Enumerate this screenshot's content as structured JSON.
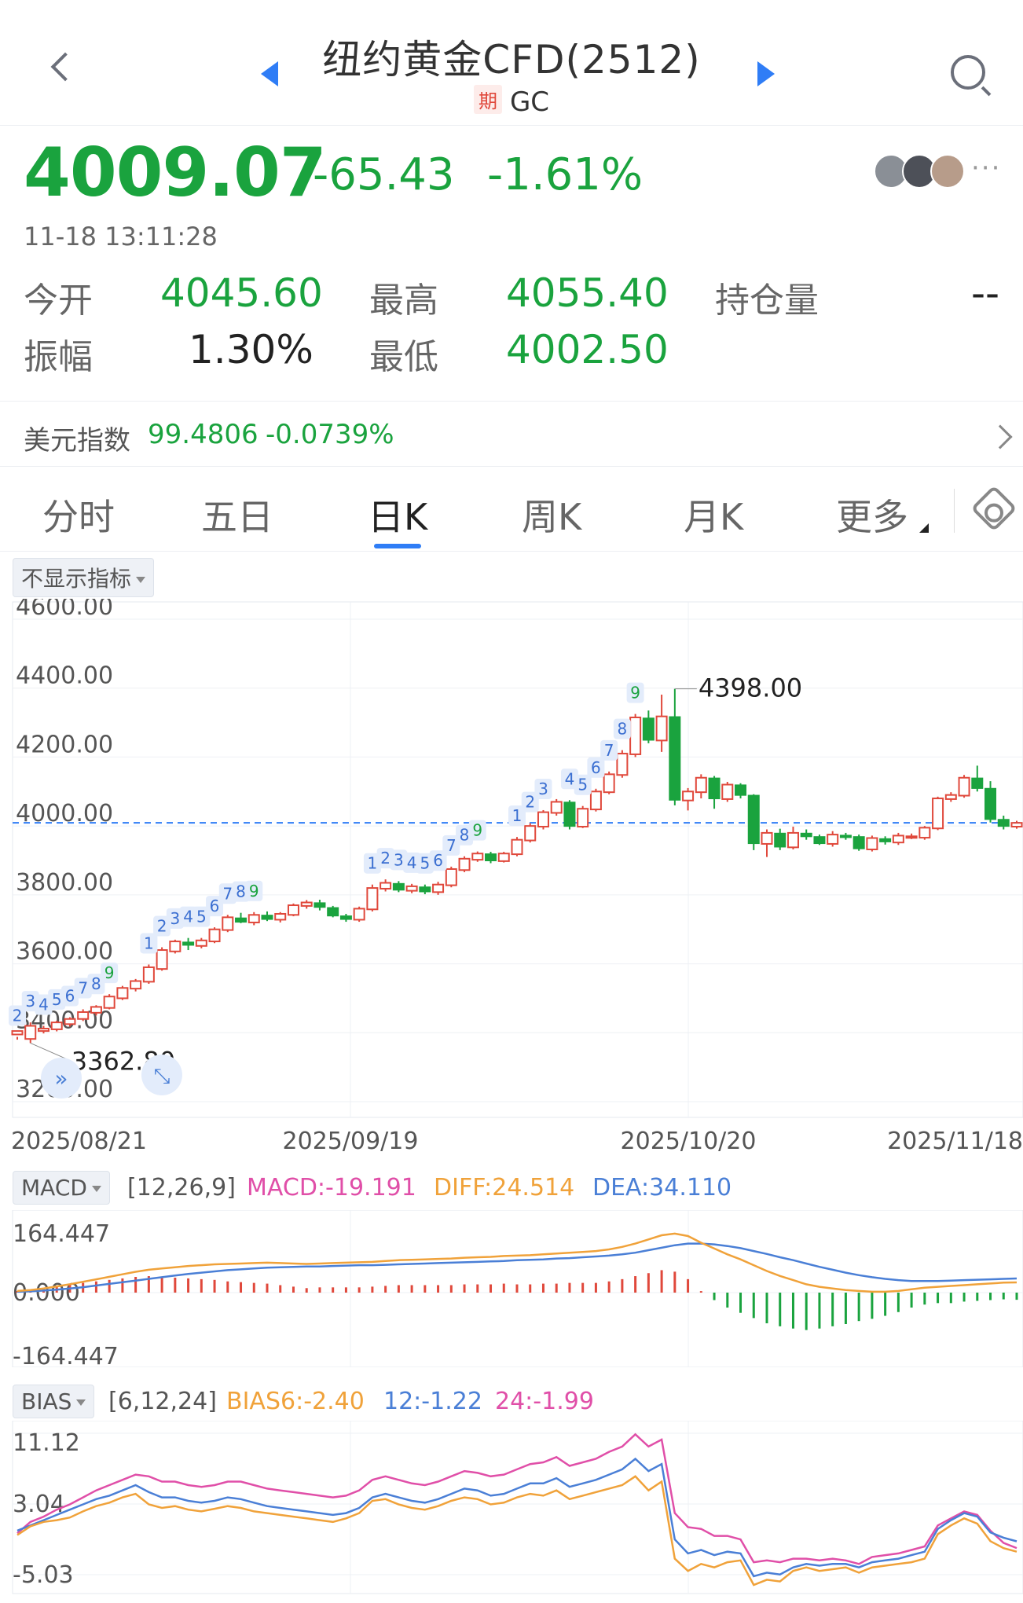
{
  "header": {
    "title": "纽约黄金CFD(2512)",
    "badge": "期",
    "code": "GC"
  },
  "quote": {
    "price": "4009.07",
    "change": "-65.43",
    "change_pct": "-1.61%",
    "timestamp": "11-18 13:11:28",
    "more": "···"
  },
  "stats": {
    "open_label": "今开",
    "open": "4045.60",
    "high_label": "最高",
    "high": "4055.40",
    "oi_label": "持仓量",
    "oi": "--",
    "amp_label": "振幅",
    "amp": "1.30%",
    "low_label": "最低",
    "low": "4002.50"
  },
  "dxy": {
    "label": "美元指数",
    "value": "99.4806",
    "change": "-0.0739%"
  },
  "tabs": [
    "分时",
    "五日",
    "日K",
    "周K",
    "月K",
    "更多"
  ],
  "active_tab": "日K",
  "indicator_toggle": "不显示指标",
  "colors": {
    "up": "#e0483b",
    "down": "#1aa33e",
    "blue": "#2f7df6",
    "orange": "#f0a23a",
    "pink": "#e04fa8",
    "dea_blue": "#4a7fd6"
  },
  "chart_data": [
    {
      "type": "candlestick",
      "ylim": [
        3200,
        4600
      ],
      "y_ticks": [
        "4600.00",
        "4400.00",
        "4200.00",
        "4000.00",
        "3800.00",
        "3600.00",
        "3400.00",
        "3200.00"
      ],
      "x_ticks": [
        "2025/08/21",
        "2025/09/19",
        "2025/10/20",
        "2025/11/18"
      ],
      "reference_price": 4009.07,
      "max_annotation": "4398.00",
      "min_annotation": "3362.80",
      "candles": [
        [
          3395,
          3405,
          3388,
          3380
        ],
        [
          3382,
          3420,
          3430,
          3370
        ],
        [
          3405,
          3412,
          3420,
          3398
        ],
        [
          3410,
          3430,
          3435,
          3404
        ],
        [
          3425,
          3440,
          3445,
          3418
        ],
        [
          3440,
          3460,
          3468,
          3434
        ],
        [
          3458,
          3475,
          3480,
          3450
        ],
        [
          3472,
          3505,
          3512,
          3468
        ],
        [
          3500,
          3530,
          3536,
          3495
        ],
        [
          3528,
          3550,
          3556,
          3520
        ],
        [
          3548,
          3590,
          3598,
          3542
        ],
        [
          3585,
          3640,
          3648,
          3580
        ],
        [
          3636,
          3665,
          3670,
          3630
        ],
        [
          3662,
          3655,
          3675,
          3640
        ],
        [
          3652,
          3668,
          3675,
          3645
        ],
        [
          3665,
          3700,
          3706,
          3660
        ],
        [
          3698,
          3735,
          3742,
          3692
        ],
        [
          3732,
          3722,
          3748,
          3718
        ],
        [
          3720,
          3742,
          3750,
          3712
        ],
        [
          3740,
          3730,
          3752,
          3724
        ],
        [
          3728,
          3745,
          3750,
          3720
        ],
        [
          3742,
          3770,
          3775,
          3738
        ],
        [
          3768,
          3778,
          3785,
          3760
        ],
        [
          3776,
          3765,
          3786,
          3755
        ],
        [
          3762,
          3740,
          3768,
          3735
        ],
        [
          3738,
          3730,
          3745,
          3722
        ],
        [
          3728,
          3760,
          3766,
          3722
        ],
        [
          3758,
          3820,
          3830,
          3752
        ],
        [
          3818,
          3835,
          3845,
          3810
        ],
        [
          3832,
          3815,
          3840,
          3808
        ],
        [
          3812,
          3825,
          3832,
          3805
        ],
        [
          3822,
          3810,
          3830,
          3802
        ],
        [
          3808,
          3830,
          3838,
          3800
        ],
        [
          3828,
          3875,
          3882,
          3822
        ],
        [
          3872,
          3905,
          3912,
          3866
        ],
        [
          3902,
          3920,
          3926,
          3896
        ],
        [
          3918,
          3900,
          3925,
          3892
        ],
        [
          3898,
          3920,
          3925,
          3894
        ],
        [
          3918,
          3960,
          3968,
          3912
        ],
        [
          3958,
          4000,
          4008,
          3952
        ],
        [
          3998,
          4040,
          4046,
          3990
        ],
        [
          4038,
          4070,
          4078,
          4030
        ],
        [
          4068,
          4000,
          4075,
          3990
        ],
        [
          3998,
          4050,
          4058,
          3994
        ],
        [
          4048,
          4100,
          4108,
          4042
        ],
        [
          4098,
          4150,
          4158,
          4092
        ],
        [
          4148,
          4210,
          4220,
          4140
        ],
        [
          4208,
          4315,
          4325,
          4200
        ],
        [
          4312,
          4250,
          4335,
          4240
        ],
        [
          4248,
          4318,
          4381,
          4215
        ],
        [
          4316,
          4076,
          4398,
          4060
        ],
        [
          4074,
          4100,
          4110,
          4045
        ],
        [
          4098,
          4140,
          4150,
          4080
        ],
        [
          4138,
          4080,
          4145,
          4050
        ],
        [
          4078,
          4120,
          4128,
          4070
        ],
        [
          4118,
          4090,
          4124,
          4080
        ],
        [
          4088,
          3950,
          4092,
          3930
        ],
        [
          3948,
          3980,
          3990,
          3910
        ],
        [
          3978,
          3940,
          3992,
          3930
        ],
        [
          3938,
          3980,
          3998,
          3932
        ],
        [
          3978,
          3970,
          3990,
          3960
        ],
        [
          3968,
          3950,
          3975,
          3945
        ],
        [
          3948,
          3975,
          3985,
          3940
        ],
        [
          3972,
          3970,
          3980,
          3960
        ],
        [
          3968,
          3935,
          3975,
          3928
        ],
        [
          3932,
          3965,
          3972,
          3926
        ],
        [
          3962,
          3955,
          3970,
          3946
        ],
        [
          3952,
          3972,
          3980,
          3945
        ],
        [
          3970,
          3970,
          3978,
          3962
        ],
        [
          3966,
          3995,
          4000,
          3960
        ],
        [
          3993,
          4080,
          4085,
          3988
        ],
        [
          4078,
          4090,
          4098,
          4070
        ],
        [
          4088,
          4140,
          4148,
          4082
        ],
        [
          4138,
          4110,
          4175,
          4100
        ],
        [
          4108,
          4020,
          4130,
          4010
        ],
        [
          4018,
          4000,
          4030,
          3990
        ],
        [
          3998,
          4009.07,
          4015,
          3992
        ]
      ],
      "td_sequences": [
        {
          "start": 0,
          "labels": [
            "2",
            "3",
            "4",
            "5",
            "6",
            "7",
            "8",
            "9"
          ]
        },
        {
          "start": 10,
          "labels": [
            "1",
            "2",
            "3",
            "4",
            "5",
            "6",
            "7",
            "8",
            "9"
          ]
        },
        {
          "start": 27,
          "labels": [
            "1",
            "2",
            "3",
            "4",
            "5",
            "6",
            "7",
            "8",
            "9"
          ]
        },
        {
          "start": 38,
          "labels": [
            "1",
            "2",
            "3"
          ]
        },
        {
          "start": 42,
          "labels": [
            "4",
            "5",
            "6",
            "7",
            "8",
            "9"
          ]
        }
      ]
    },
    {
      "type": "macd",
      "button": "MACD",
      "params": "[12,26,9]",
      "macd_label": "MACD:-19.191",
      "diff_label": "DIFF:24.514",
      "dea_label": "DEA:34.110",
      "y_ticks": [
        "164.447",
        "0.000",
        "-164.447"
      ],
      "ylim": [
        -164.447,
        164.447
      ],
      "diff": [
        4,
        6,
        10,
        15,
        20,
        26,
        32,
        38,
        44,
        50,
        55,
        58,
        61,
        64,
        66,
        68,
        69,
        70,
        71,
        72,
        71,
        70,
        69,
        70,
        71,
        72,
        73,
        74,
        76,
        78,
        79,
        80,
        81,
        82,
        84,
        85,
        86,
        88,
        89,
        90,
        92,
        94,
        96,
        98,
        100,
        104,
        110,
        118,
        128,
        138,
        142,
        136,
        120,
        106,
        92,
        80,
        66,
        52,
        40,
        30,
        20,
        14,
        10,
        6,
        4,
        2,
        2,
        4,
        8,
        12,
        14,
        16,
        18,
        20,
        22,
        24,
        24.514
      ],
      "dea": [
        2,
        3,
        5,
        7,
        10,
        13,
        17,
        21,
        25,
        29,
        33,
        37,
        41,
        45,
        48,
        51,
        54,
        56,
        58,
        60,
        61,
        62,
        63,
        63,
        64,
        65,
        66,
        66,
        67,
        68,
        69,
        70,
        71,
        72,
        73,
        74,
        75,
        76,
        78,
        79,
        80,
        82,
        83,
        85,
        87,
        89,
        92,
        96,
        102,
        108,
        114,
        118,
        118,
        116,
        112,
        107,
        100,
        93,
        85,
        78,
        70,
        62,
        55,
        48,
        42,
        37,
        33,
        30,
        28,
        28,
        28,
        29,
        30,
        31,
        32,
        33,
        34.11
      ],
      "hist": [
        4,
        6,
        10,
        16,
        20,
        26,
        30,
        34,
        38,
        42,
        44,
        42,
        40,
        38,
        36,
        34,
        30,
        28,
        26,
        24,
        20,
        16,
        12,
        14,
        14,
        14,
        14,
        16,
        18,
        20,
        20,
        20,
        20,
        20,
        22,
        22,
        22,
        24,
        22,
        22,
        24,
        24,
        26,
        26,
        26,
        30,
        36,
        44,
        52,
        60,
        56,
        36,
        4,
        -20,
        -40,
        -54,
        -68,
        -82,
        -90,
        -96,
        -100,
        -96,
        -90,
        -84,
        -76,
        -70,
        -62,
        -52,
        -40,
        -32,
        -28,
        -28,
        -24,
        -22,
        -20,
        -18,
        -19.191
      ]
    },
    {
      "type": "bias",
      "button": "BIAS",
      "params": "[6,12,24]",
      "bias6_label": "BIAS6:-2.40",
      "bias12_label": "12:-1.22",
      "bias24_label": "24:-1.99",
      "y_ticks": [
        "11.12",
        "3.04",
        "-5.03"
      ],
      "ylim": [
        -5.03,
        11.12
      ],
      "bias6": [
        -0.5,
        0.5,
        1.0,
        1.2,
        1.5,
        2.2,
        2.8,
        3.2,
        3.8,
        4.2,
        3.0,
        2.6,
        2.8,
        2.4,
        2.2,
        2.5,
        2.8,
        2.6,
        2.2,
        2.0,
        1.8,
        1.6,
        1.4,
        1.2,
        1.0,
        1.4,
        2.0,
        3.4,
        3.6,
        3.0,
        2.6,
        2.4,
        2.8,
        3.4,
        3.8,
        3.6,
        3.0,
        3.2,
        3.8,
        4.2,
        4.0,
        4.6,
        3.6,
        4.0,
        4.4,
        4.8,
        5.2,
        6.2,
        4.6,
        5.6,
        -3.2,
        -4.6,
        -3.8,
        -4.2,
        -3.6,
        -3.4,
        -6.2,
        -5.6,
        -5.8,
        -4.6,
        -4.2,
        -4.6,
        -4.4,
        -4.2,
        -4.8,
        -4.2,
        -4.0,
        -3.8,
        -3.6,
        -3.2,
        -0.4,
        0.6,
        1.4,
        0.8,
        -1.2,
        -2.0,
        -2.4
      ],
      "bias12": [
        0.0,
        0.6,
        1.2,
        1.8,
        2.4,
        3.0,
        3.6,
        4.0,
        4.6,
        5.2,
        4.4,
        3.8,
        3.8,
        3.4,
        3.2,
        3.4,
        3.8,
        3.6,
        3.2,
        2.8,
        2.6,
        2.4,
        2.2,
        2.0,
        1.8,
        2.0,
        2.6,
        3.8,
        4.2,
        3.8,
        3.4,
        3.2,
        3.6,
        4.2,
        4.8,
        4.6,
        4.0,
        4.2,
        4.8,
        5.4,
        5.4,
        6.0,
        5.0,
        5.4,
        5.8,
        6.4,
        7.0,
        8.2,
        6.8,
        7.6,
        -1.0,
        -2.6,
        -2.2,
        -2.8,
        -2.4,
        -2.6,
        -5.2,
        -4.8,
        -5.0,
        -4.2,
        -3.8,
        -4.0,
        -3.8,
        -3.8,
        -4.2,
        -3.6,
        -3.4,
        -3.2,
        -2.8,
        -2.4,
        0.2,
        1.2,
        2.0,
        1.6,
        -0.2,
        -0.8,
        -1.22
      ],
      "bias24": [
        -0.3,
        1.0,
        1.6,
        2.4,
        3.0,
        3.8,
        4.6,
        5.2,
        5.8,
        6.4,
        6.2,
        5.6,
        5.6,
        5.2,
        5.0,
        5.2,
        5.6,
        5.6,
        5.2,
        4.8,
        4.6,
        4.4,
        4.2,
        4.0,
        3.8,
        4.0,
        4.6,
        5.8,
        6.2,
        5.8,
        5.4,
        5.2,
        5.6,
        6.2,
        6.8,
        6.6,
        6.2,
        6.4,
        7.0,
        7.6,
        7.8,
        8.4,
        7.4,
        7.8,
        8.2,
        9.0,
        9.6,
        11.0,
        9.6,
        10.4,
        2.0,
        0.4,
        0.2,
        -0.6,
        -0.6,
        -1.0,
        -3.6,
        -3.4,
        -3.6,
        -3.2,
        -3.2,
        -3.4,
        -3.2,
        -3.4,
        -3.8,
        -3.0,
        -2.8,
        -2.6,
        -2.2,
        -1.8,
        0.6,
        1.4,
        2.2,
        1.8,
        0.0,
        -1.4,
        -1.99
      ]
    }
  ]
}
